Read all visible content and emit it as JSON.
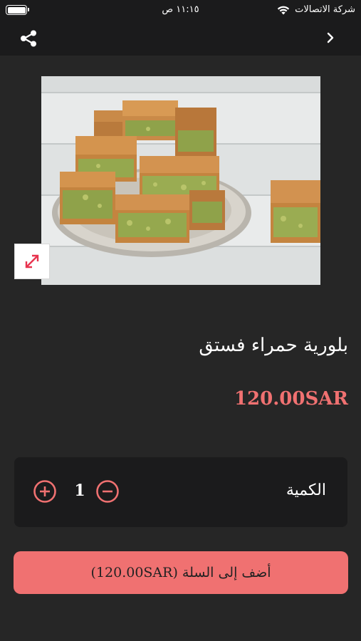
{
  "status_bar": {
    "time": "١١:١٥ ص",
    "carrier": "شركة الاتصالات",
    "battery_level": 1.0,
    "wifi_icon": "wifi-icon"
  },
  "nav": {
    "share_icon": "share-icon",
    "back_icon": "chevron-right-icon"
  },
  "product": {
    "name": "بلورية حمراء فستق",
    "price": "120.00SAR",
    "expand_icon": "expand-arrows-icon"
  },
  "quantity": {
    "label": "الكمية",
    "value": "1",
    "plus_icon": "plus-circle-icon",
    "minus_icon": "minus-circle-icon"
  },
  "cart": {
    "button_label": "أضف إلى السلة (120.00SAR)"
  },
  "colors": {
    "accent": "#f07171",
    "background": "#262626",
    "bar": "#1b1b1c"
  }
}
